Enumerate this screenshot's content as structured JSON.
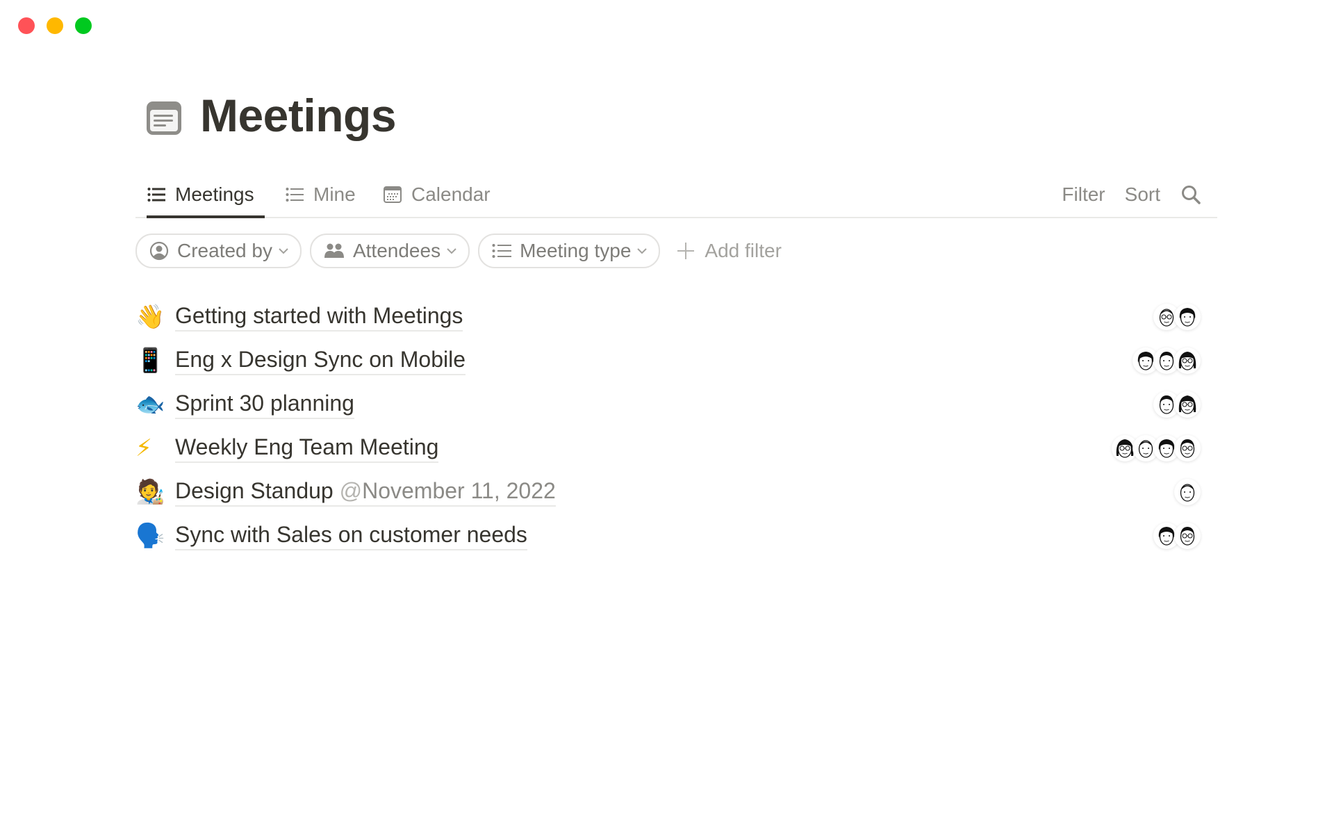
{
  "window": {
    "controls": [
      "close",
      "minimize",
      "maximize"
    ]
  },
  "page": {
    "icon": "document-icon",
    "title": "Meetings"
  },
  "tabs": [
    {
      "label": "Meetings",
      "icon": "list-icon",
      "active": true
    },
    {
      "label": "Mine",
      "icon": "list-icon",
      "active": false
    },
    {
      "label": "Calendar",
      "icon": "calendar-icon",
      "active": false
    }
  ],
  "actions": {
    "filter_label": "Filter",
    "sort_label": "Sort",
    "search_icon": "search-icon"
  },
  "filters": [
    {
      "label": "Created by",
      "icon": "person-circle-icon"
    },
    {
      "label": "Attendees",
      "icon": "people-icon"
    },
    {
      "label": "Meeting type",
      "icon": "list-icon"
    }
  ],
  "add_filter_label": "Add filter",
  "meetings": [
    {
      "emoji": "👋",
      "title": "Getting started with Meetings",
      "mention": "",
      "attendee_count": 2
    },
    {
      "emoji": "📱",
      "title": "Eng x Design Sync on Mobile",
      "mention": "",
      "attendee_count": 3
    },
    {
      "emoji": "🐟",
      "title": "Sprint 30 planning",
      "mention": "",
      "attendee_count": 2
    },
    {
      "emoji": "⚡",
      "title": "Weekly Eng Team Meeting",
      "mention": "",
      "attendee_count": 4
    },
    {
      "emoji": "🧑‍🎨",
      "title": "Design Standup",
      "mention_at": "@",
      "mention": "November 11, 2022",
      "attendee_count": 1
    },
    {
      "emoji": "🗣️",
      "title": "Sync with Sales on customer needs",
      "mention": "",
      "attendee_count": 2
    }
  ]
}
